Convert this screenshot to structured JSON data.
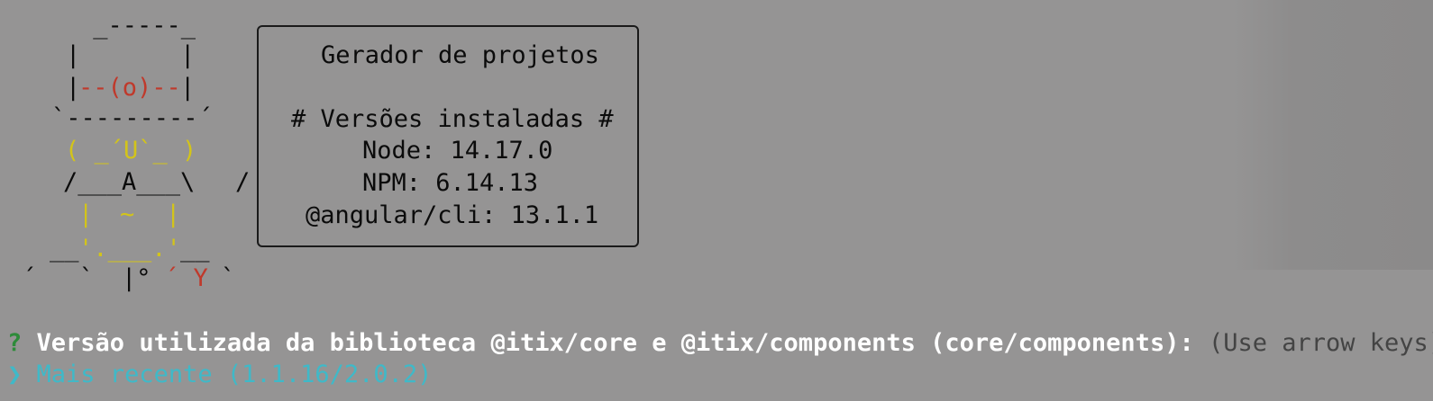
{
  "ascii_art": {
    "line1": " _-----_",
    "line2_left": "|",
    "line2_right": "|",
    "line3_left": "|",
    "line3_mid": "--(o)--",
    "line3_right": "|",
    "line4": "`---------´",
    "line5": "( _´U`_ )",
    "line6": "/___A___\\",
    "line6_slash": "/",
    "line7_left": "|",
    "line7_mid": "~",
    "line7_right": "|",
    "line8_under_left": "__",
    "line8_yellow": "'.___.'",
    "line8_under_right": "__",
    "line9_left": "´",
    "line9_tick": "`",
    "line9_pipe": "|°",
    "line9_red": "´ Y",
    "line9_end": "`"
  },
  "info_box": {
    "title": "Gerador de projetos",
    "versions_header": "# Versões instaladas #",
    "node": "Node: 14.17.0",
    "npm": "NPM: 6.14.13",
    "angular": "@angular/cli: 13.1.1"
  },
  "prompt": {
    "marker": "?",
    "question": "Versão utilizada da biblioteca @itix/core e @itix/components (core/components):",
    "hint": "(Use arrow keys)"
  },
  "choices": [
    {
      "pointer": "❯",
      "label": "Mais recente (1.1.16/2.0.2)",
      "selected": true
    }
  ],
  "colors": {
    "background": "#959494",
    "accent_cyan": "#3fb9c8",
    "question_mark_green": "#2e8b3a",
    "logo_red": "#c0392b",
    "logo_yellow": "#d3c41a"
  }
}
